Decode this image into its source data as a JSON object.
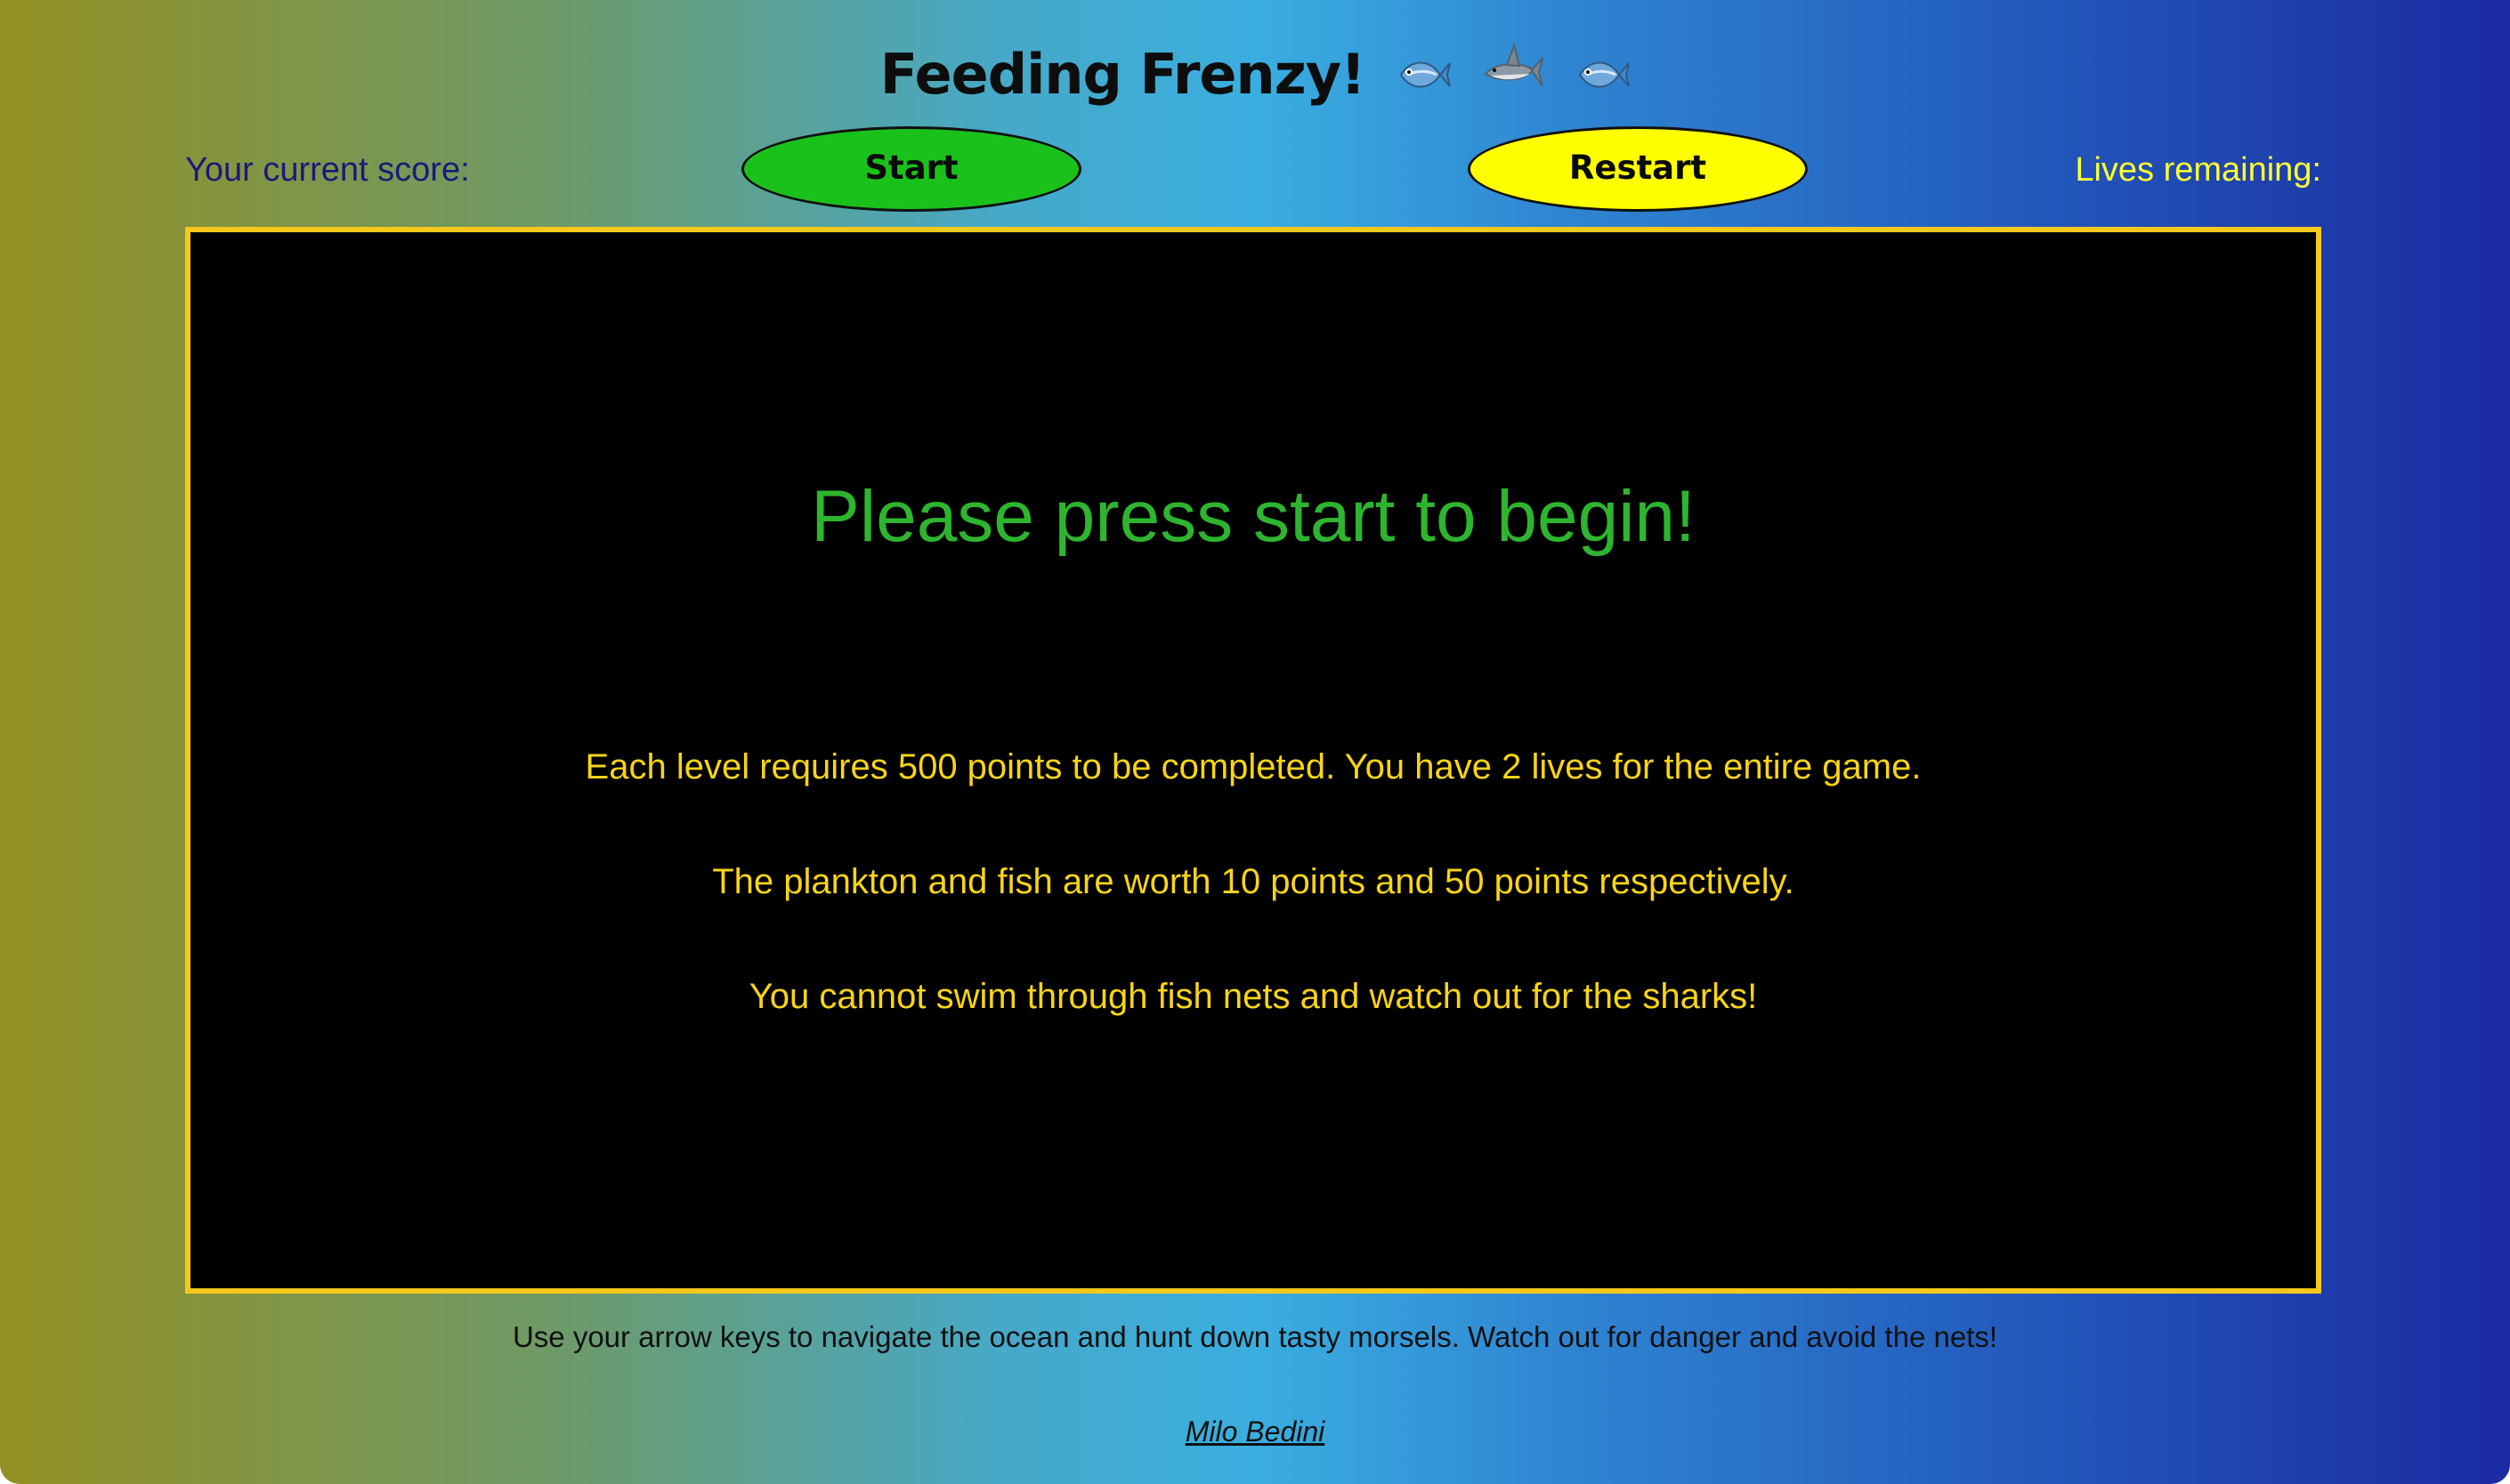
{
  "header": {
    "title": "Feeding Frenzy!",
    "title_icons": [
      "fish-icon",
      "shark-icon",
      "fish-icon"
    ],
    "score_label": "Your current score:",
    "lives_label": "Lives remaining:",
    "start_label": "Start",
    "restart_label": "Restart"
  },
  "board": {
    "message": "Please press start to begin!",
    "rules": [
      "Each level requires 500 points to be completed. You have 2 lives for the entire game.",
      "The plankton and fish are worth 10 points and 50 points respectively.",
      "You cannot swim through fish nets and watch out for the sharks!"
    ]
  },
  "footer": {
    "instructions": "Use your arrow keys to navigate the ocean and hunt down tasty morsels. Watch out for danger and avoid the nets!",
    "author": "Milo Bedini"
  },
  "colors": {
    "start_button": "#1bc11b",
    "restart_button": "#ffff00",
    "board_border": "#f6c81b",
    "message": "#2eb52e",
    "rules": "#f7d418",
    "score_label": "#1a1a7a",
    "lives_label": "#ffff33"
  }
}
